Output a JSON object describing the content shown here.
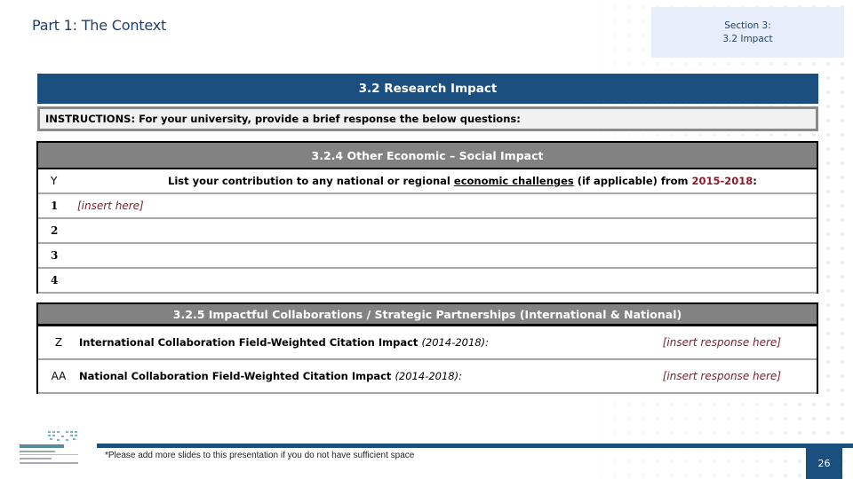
{
  "header": {
    "part_title": "Part 1: The Context",
    "section_line1": "Section 3:",
    "section_line2": "3.2 Impact"
  },
  "research": {
    "title": "3.2 Research Impact",
    "instructions": "INSTRUCTIONS: For your university, provide a brief response the below questions:"
  },
  "table_324": {
    "title": "3.2.4 Other Economic – Social Impact",
    "question_id": "Y",
    "question_prefix": "List your contribution to any national or regional ",
    "question_underlined": "economic challenges",
    "question_mid": " (if applicable) from ",
    "question_years": "2015-2018",
    "question_suffix": ":",
    "rows": [
      {
        "index": "1",
        "value": "[insert here]"
      },
      {
        "index": "2",
        "value": ""
      },
      {
        "index": "3",
        "value": ""
      },
      {
        "index": "4",
        "value": ""
      }
    ]
  },
  "table_325": {
    "title": "3.2.5 Impactful Collaborations / Strategic Partnerships (International & National)",
    "rows": [
      {
        "id": "Z",
        "label": "International Collaboration Field-Weighted Citation Impact ",
        "period": "(2014-2018):",
        "response": "[insert response here]"
      },
      {
        "id": "AA",
        "label": "National Collaboration Field-Weighted Citation Impact ",
        "period": "(2014-2018):",
        "response": "[insert response here]"
      }
    ]
  },
  "footer": {
    "note": "*Please add more slides to this presentation if you do not have sufficient space",
    "page_number": "26",
    "logo": "ministry-of-education-logo"
  },
  "colors": {
    "primary_blue": "#1b4f80",
    "header_gray": "#828282",
    "accent_red": "#8b1c2a",
    "section_box_bg": "#e8eef9"
  }
}
